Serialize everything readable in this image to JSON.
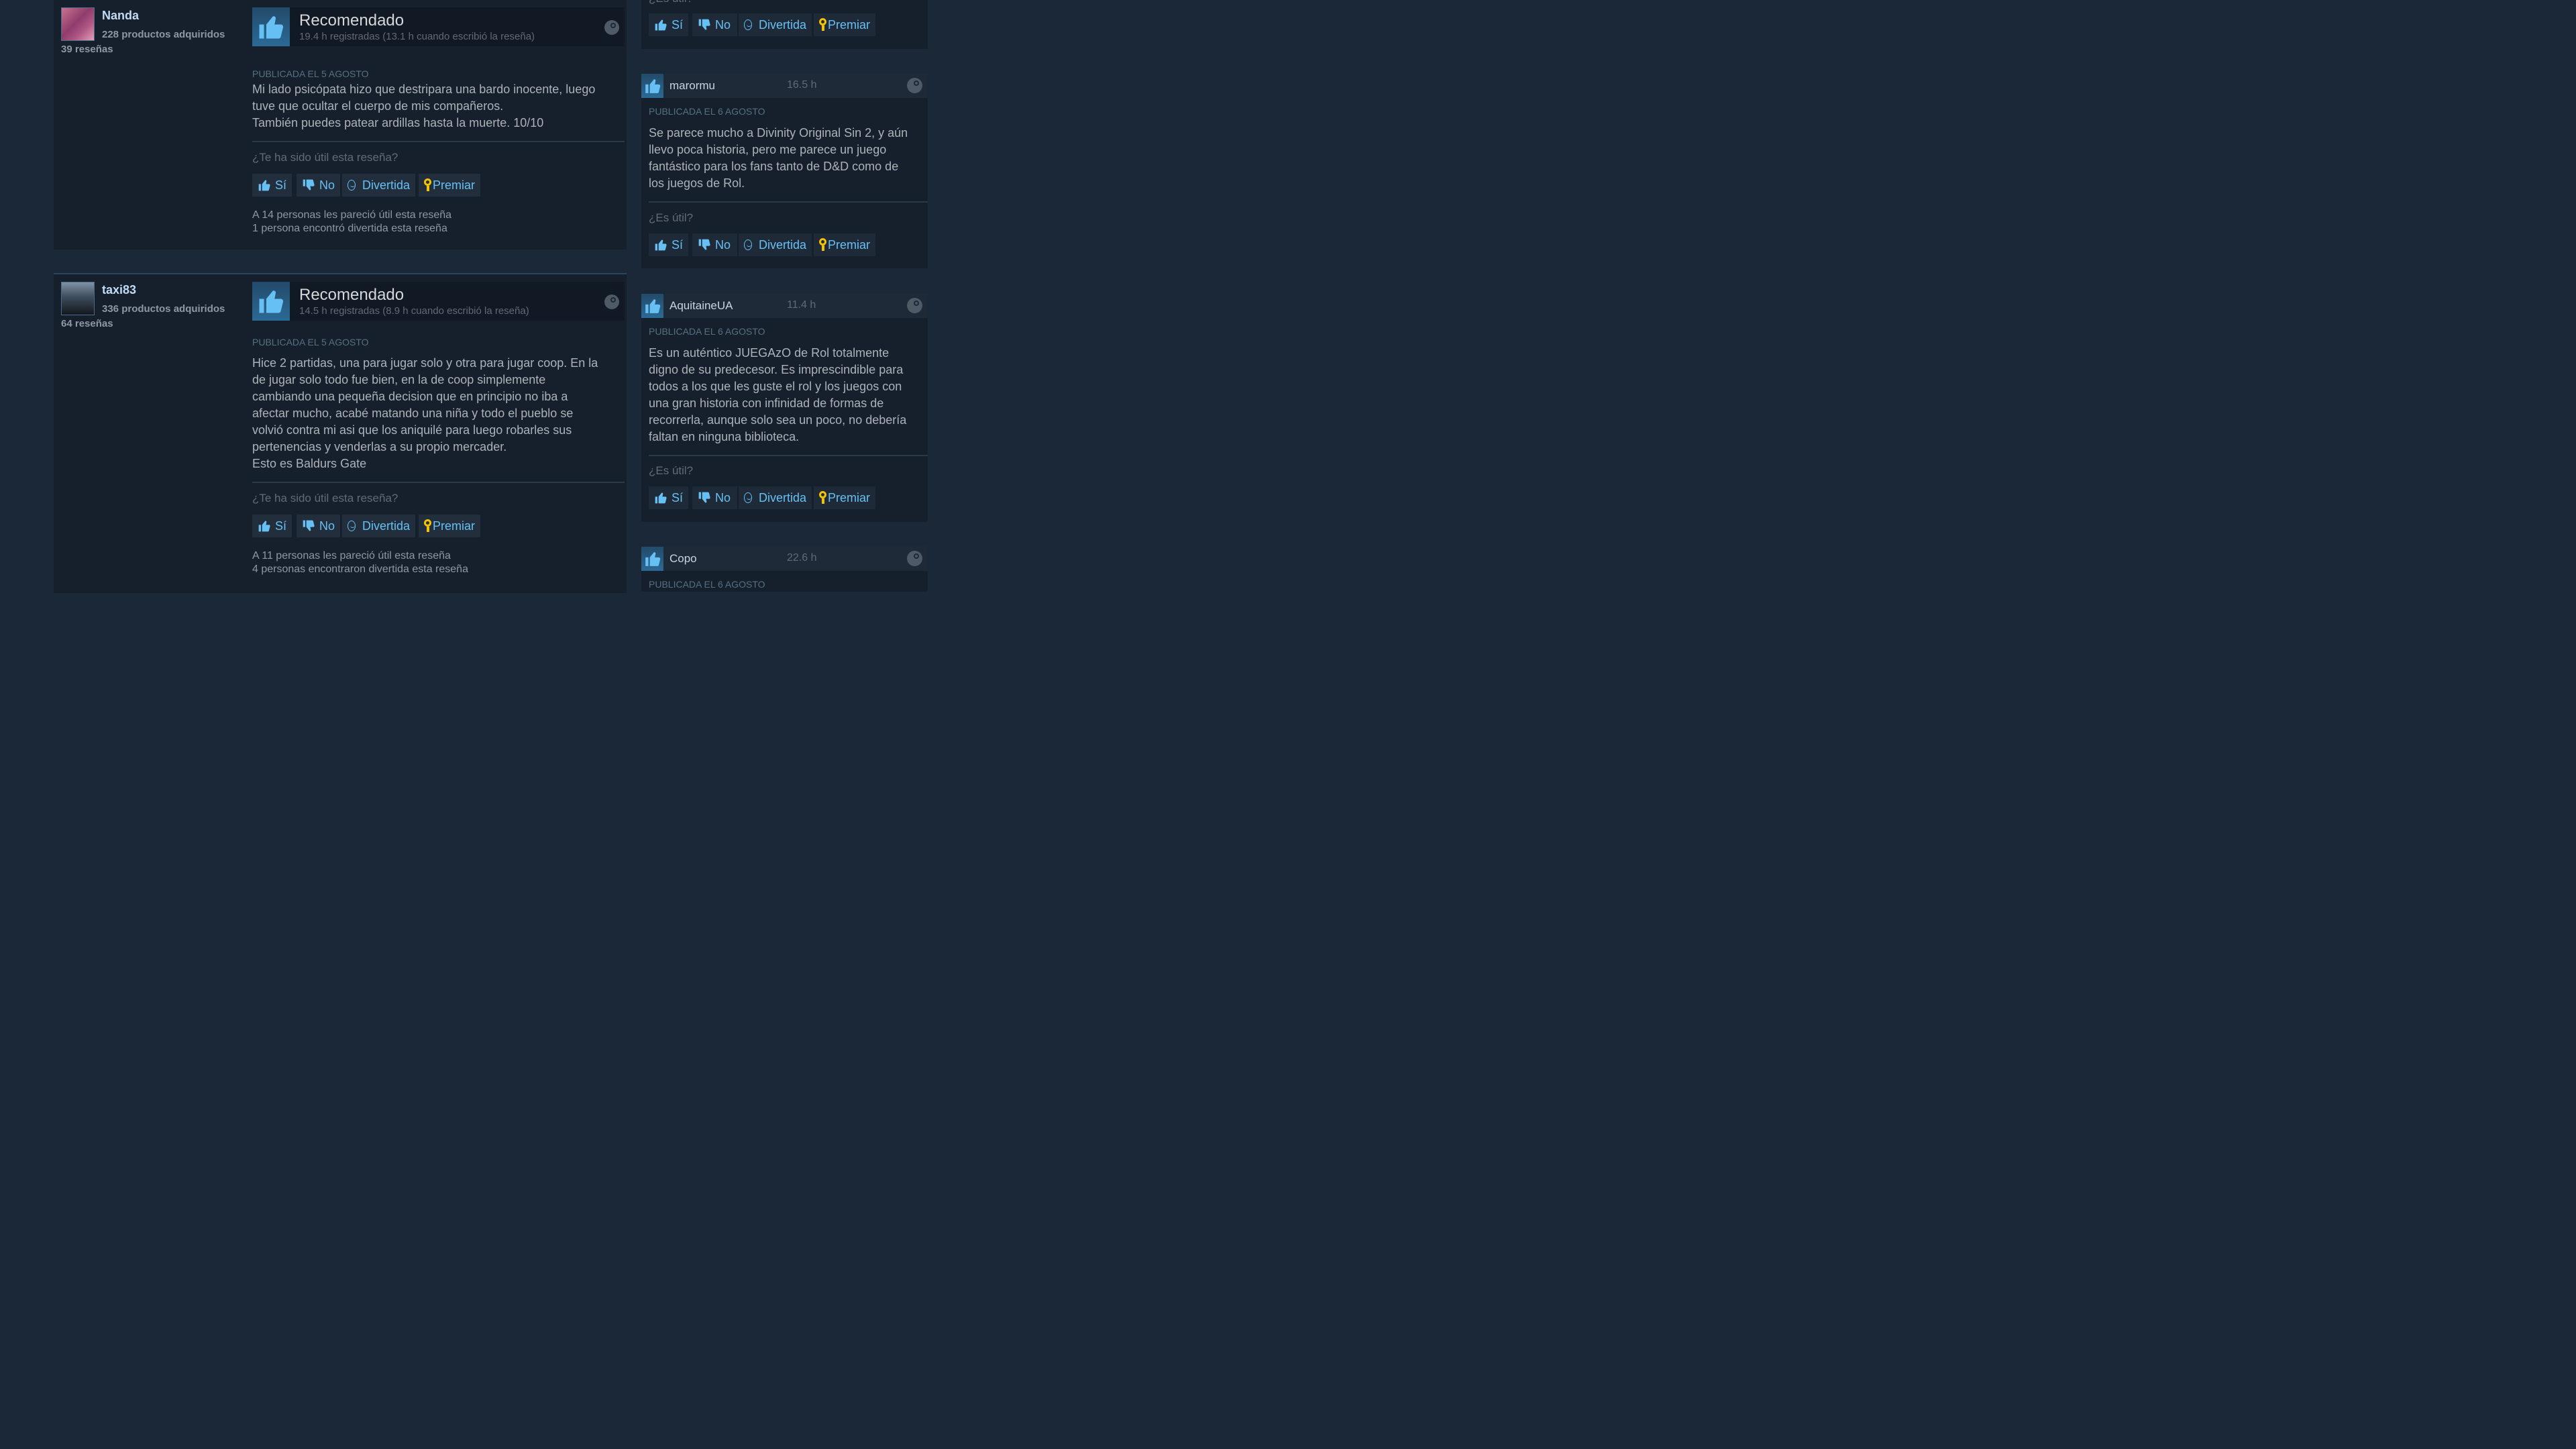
{
  "colors": {
    "page_bg": "#1b2838",
    "card_bg": "#16202d",
    "link_blue": "#66c0f4",
    "award_gold": "#f3c200"
  },
  "reviews_main": [
    {
      "username": "Nanda",
      "products": "228 productos adquiridos",
      "review_count": "39 reseñas",
      "avatar_icon": "anime-avatar-pink",
      "verdict": "Recomendado",
      "hours": "19.4 h registradas (13.1 h cuando escribió la reseña)",
      "posted": "PUBLICADA EL 5 AGOSTO",
      "text_lines": [
        "Mi lado psicópata hizo que destripara una bardo inocente, luego",
        "tuve que ocultar el cuerpo de mis compañeros.",
        "También puedes patear ardillas hasta la muerte. 10/10"
      ],
      "question": "¿Te ha sido útil esta reseña?",
      "buttons": {
        "yes": "Sí",
        "no": "No",
        "funny": "Divertida",
        "award": "Premiar"
      },
      "stat_helpful": "A 14 personas les pareció útil esta reseña",
      "stat_funny": "1 persona encontró divertida esta reseña"
    },
    {
      "username": "taxi83",
      "products": "336 productos adquiridos",
      "review_count": "64 reseñas",
      "avatar_icon": "hooded-figure-avatar",
      "verdict": "Recomendado",
      "hours": "14.5 h registradas (8.9 h cuando escribió la reseña)",
      "posted": "PUBLICADA EL 5 AGOSTO",
      "text_lines": [
        "Hice 2 partidas, una para jugar solo y otra para jugar coop. En la",
        "de jugar solo todo fue bien, en la de coop simplemente",
        "cambiando una pequeña decision que en principio no iba a",
        "afectar mucho, acabé matando una niña y todo el pueblo se",
        "volvió contra mi asi que los aniquilé para luego robarles sus",
        "pertenencias y venderlas a su propio mercader.",
        "Esto es Baldurs Gate"
      ],
      "question": "¿Te ha sido útil esta reseña?",
      "buttons": {
        "yes": "Sí",
        "no": "No",
        "funny": "Divertida",
        "award": "Premiar"
      },
      "stat_helpful": "A 11 personas les pareció útil esta reseña",
      "stat_funny": "4 personas encontraron divertida esta reseña"
    }
  ],
  "side_top": {
    "question": "¿Es útil?",
    "buttons": {
      "yes": "Sí",
      "no": "No",
      "funny": "Divertida",
      "award": "Premiar"
    }
  },
  "reviews_side": [
    {
      "username": "marormu",
      "hours": "16.5 h",
      "posted": "PUBLICADA EL 6 AGOSTO",
      "text_lines": [
        "Se parece mucho a Divinity Original Sin 2, y aún",
        "llevo poca historia, pero me parece un juego",
        "fantástico para los fans tanto de D&D como de",
        "los juegos de Rol."
      ],
      "question": "¿Es útil?",
      "buttons": {
        "yes": "Sí",
        "no": "No",
        "funny": "Divertida",
        "award": "Premiar"
      }
    },
    {
      "username": "AquitaineUA",
      "hours": "11.4 h",
      "posted": "PUBLICADA EL 6 AGOSTO",
      "text_lines": [
        "Es un auténtico JUEGAzO de Rol totalmente",
        "digno de su predecesor. Es imprescindible para",
        "todos a los que les guste el rol y los juegos con",
        "una gran historia con infinidad de formas de",
        "recorrerla, aunque solo sea un poco, no debería",
        "faltan en ninguna biblioteca."
      ],
      "question": "¿Es útil?",
      "buttons": {
        "yes": "Sí",
        "no": "No",
        "funny": "Divertida",
        "award": "Premiar"
      }
    },
    {
      "username": "Copo",
      "hours": "22.6 h",
      "posted": "PUBLICADA EL 6 AGOSTO"
    }
  ]
}
